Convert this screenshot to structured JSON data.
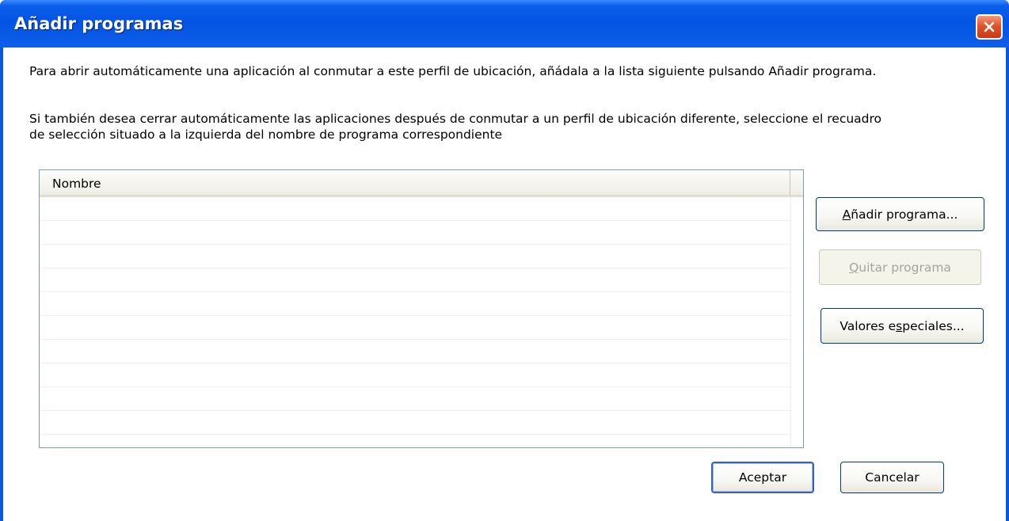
{
  "window": {
    "title": "Añadir programas"
  },
  "description": {
    "line1": "Para abrir automáticamente una aplicación al conmutar a este perfil de ubicación, añádala a la lista siguiente pulsando Añadir programa.",
    "line2": "Si también desea cerrar automáticamente las aplicaciones después de conmutar a un perfil de ubicación diferente, seleccione el recuadro",
    "line3": "de selección situado a la izquierda del nombre de programa correspondiente"
  },
  "program_list": {
    "column_header": "Nombre",
    "rows": []
  },
  "buttons": {
    "add_program": {
      "accel": "A",
      "rest": "ñadir programa..."
    },
    "remove_program": {
      "accel": "Q",
      "rest": "uitar programa",
      "enabled": false
    },
    "special_values": {
      "pre": "Valores e",
      "accel": "s",
      "post": "peciales..."
    },
    "ok": "Aceptar",
    "cancel": "Cancelar"
  },
  "colors": {
    "titlebar": "#0454e4",
    "close_button": "#e0542a",
    "button_border": "#003c74"
  },
  "icons": {
    "close": "close-x-icon"
  }
}
